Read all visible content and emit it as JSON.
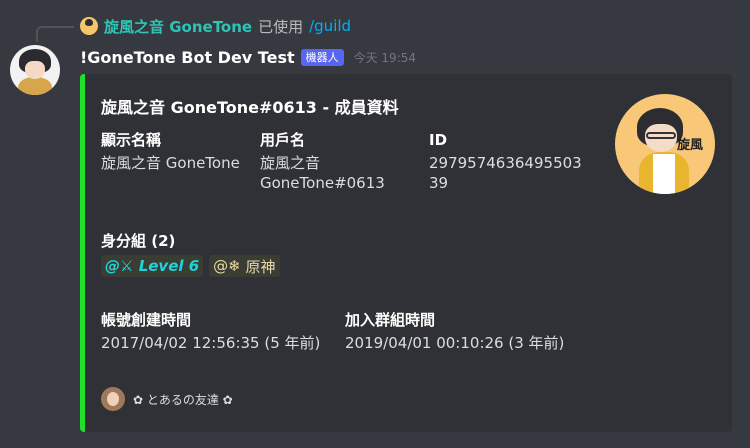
{
  "reply": {
    "user": "旋風之音 GoneTone",
    "action": "已使用",
    "command": "/guild"
  },
  "message": {
    "username": "!GoneTone Bot Dev Test",
    "bot_tag": "機器人",
    "timestamp": "今天 19:54"
  },
  "embed": {
    "accent_color": "#1ee12a",
    "title": "旋風之音 GoneTone#0613 - 成員資料",
    "thumbnail_text": "旋風",
    "fields": {
      "display_name": {
        "name": "顯示名稱",
        "value": "旋風之音 GoneTone"
      },
      "username": {
        "name": "用戶名",
        "value_line1": "旋風之音",
        "value_line2": "GoneTone#0613"
      },
      "id": {
        "name": "ID",
        "value_line1": "2979574636495503",
        "value_line2": "39"
      },
      "roles": {
        "name": "身分組 (2)",
        "items": [
          {
            "prefix": "@",
            "icon": "⚔",
            "label": "Level 6",
            "color": "#1fd3e0"
          },
          {
            "prefix": "@",
            "icon": "❄",
            "label": "原神",
            "color": "#e9d8a6"
          }
        ]
      },
      "created": {
        "name": "帳號創建時間",
        "value": "2017/04/02 12:56:35 (5 年前)"
      },
      "joined": {
        "name": "加入群組時間",
        "value": "2019/04/01 00:10:26 (3 年前)"
      }
    },
    "footer": {
      "text": "✿ とあるの友達 ✿"
    }
  }
}
